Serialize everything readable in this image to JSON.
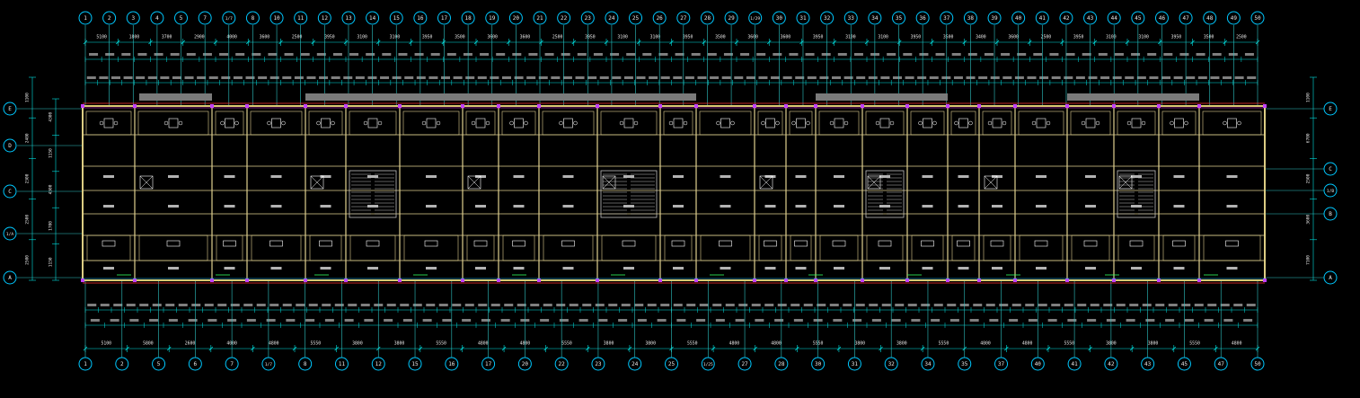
{
  "colors": {
    "background": "#000000",
    "axis_line": "#2ec4c4",
    "axis_bubble": "#00c8ff",
    "dimension": "#00e0e0",
    "dimension_text": "#e8e8e8",
    "wall": "#d8c870",
    "wall_inner": "#e0d090",
    "room_label": "#ffffff",
    "furniture": "#ffffff",
    "stair": "#c0c0c0",
    "window": "#ff3030",
    "column_accent": "#c040ff",
    "balcony_bar": "#7a7a7a",
    "magenta": "#ff40ff"
  },
  "top_axes": [
    "1",
    "2",
    "3",
    "4",
    "5",
    "7",
    "1/7",
    "8",
    "10",
    "11",
    "12",
    "13",
    "14",
    "15",
    "16",
    "17",
    "18",
    "19",
    "20",
    "21",
    "22",
    "23",
    "24",
    "25",
    "26",
    "27",
    "28",
    "29",
    "1/29",
    "30",
    "31",
    "32",
    "33",
    "34",
    "35",
    "36",
    "37",
    "38",
    "39",
    "40",
    "41",
    "42",
    "43",
    "44",
    "45",
    "46",
    "47",
    "48",
    "49",
    "50"
  ],
  "bottom_axes": [
    "1",
    "2",
    "5",
    "6",
    "7",
    "1/7",
    "8",
    "11",
    "12",
    "15",
    "16",
    "17",
    "20",
    "22",
    "23",
    "24",
    "25",
    "1/25",
    "27",
    "28",
    "30",
    "31",
    "32",
    "34",
    "35",
    "37",
    "40",
    "41",
    "42",
    "43",
    "45",
    "47",
    "50"
  ],
  "left_axes": [
    "E",
    "D",
    "C",
    "1/A",
    "A"
  ],
  "right_axes": [
    "E",
    "C",
    "1/B",
    "B",
    "A"
  ],
  "top_dims_row1": [
    "5100",
    "1800",
    "3700",
    "2900",
    "4000",
    "3600",
    "2500",
    "3950",
    "3100",
    "3100",
    "3950",
    "3500",
    "3600",
    "3600",
    "2500",
    "3950",
    "3100",
    "3100",
    "3950",
    "3500",
    "3600",
    "3600",
    "3950",
    "3100",
    "3100",
    "3950",
    "3500",
    "3400",
    "3600",
    "2500",
    "3950",
    "3100",
    "3100",
    "3950",
    "3500",
    "2500"
  ],
  "bottom_dims_row1": [
    "5100",
    "5800",
    "2600",
    "4000",
    "4800",
    "5550",
    "3800",
    "3800",
    "5550",
    "4800",
    "4800",
    "5550",
    "3800",
    "3800",
    "5550",
    "4800",
    "4800",
    "5550",
    "3800",
    "3800",
    "5550",
    "4800",
    "4800",
    "5550",
    "3800",
    "3800",
    "5550",
    "4800"
  ],
  "left_dims": [
    "1100",
    "2400",
    "2300",
    "2500",
    "2500",
    "4300",
    "1150",
    "4300",
    "1700",
    "1150"
  ],
  "right_dims": [
    "1100",
    "6700",
    "2500",
    "3600",
    "7100"
  ]
}
